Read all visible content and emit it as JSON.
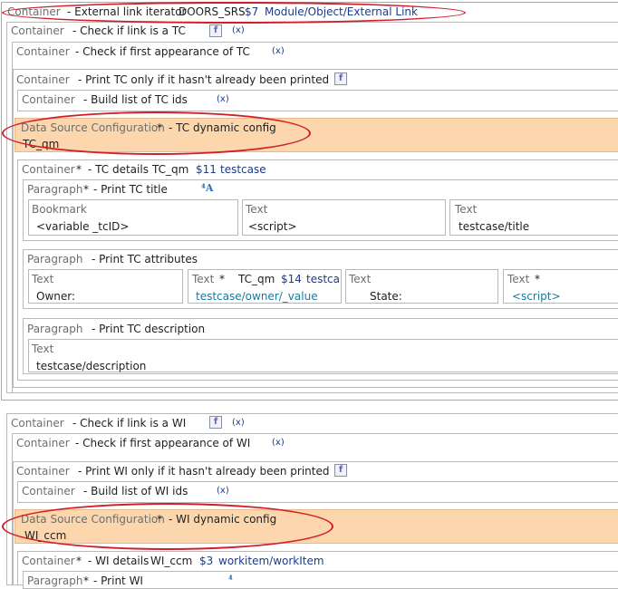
{
  "t": {
    "container": "Container",
    "paragraph": "Paragraph",
    "text": "Text",
    "bookmark": "Bookmark",
    "data_source": "Data Source Configuration",
    "star": "*",
    "x_mark": "(x)"
  },
  "rows": {
    "r1_desc": "- External link iterator",
    "r1_src": "DOORS_SRS",
    "r1_num": "$7",
    "r1_path": "Module/Object/External Link",
    "r2_desc": "- Check if link is a TC",
    "r3_desc": "- Check if first appearance of TC",
    "r4_desc": "- Print TC only if it hasn't already been printed",
    "r5_desc": "- Build list of TC ids",
    "ds1_desc": "- TC dynamic config",
    "ds1_val": "TC_qm",
    "r6_desc": "- TC details",
    "r6_src": "TC_qm",
    "r6_num": "$11",
    "r6_path": "testcase",
    "p1_desc": "- Print TC title",
    "p1_bm_val": "<variable _tcID>",
    "p1_t1_val": "<script>",
    "p1_t2_val": "testcase/title",
    "p2_desc": "- Print TC attributes",
    "p2_t1_val": "Owner:",
    "p2_t2_src": "TC_qm",
    "p2_t2_num": "$14",
    "p2_t2_path": "testcas",
    "p2_t2_val": "testcase/owner/_value",
    "p2_t3_val": "State:",
    "p2_t4_val": "<script>",
    "p3_desc": "- Print TC description",
    "p3_t1_val": "testcase/description",
    "w2_desc": "- Check if link is a WI",
    "w3_desc": "- Check if first appearance of WI",
    "w4_desc": "- Print WI only if it hasn't already been printed",
    "w5_desc": "- Build list of WI ids",
    "ds2_desc": "- WI dynamic config",
    "ds2_val": "WI_ccm",
    "w6_desc": "- WI details",
    "w6_src": "WI_ccm",
    "w6_num": "$3",
    "w6_path": "workitem/workItem",
    "w7_desc": "- Print WI"
  },
  "icons": {
    "script": "script-edit-icon",
    "font": "font-size-icon",
    "x": "clear-icon"
  },
  "colors": {
    "highlight_ellipse": "#d01f2a",
    "data_source_bg": "#fcd7ae",
    "link_blue": "#1a3c8a",
    "teal_value": "#1a7a9a"
  }
}
